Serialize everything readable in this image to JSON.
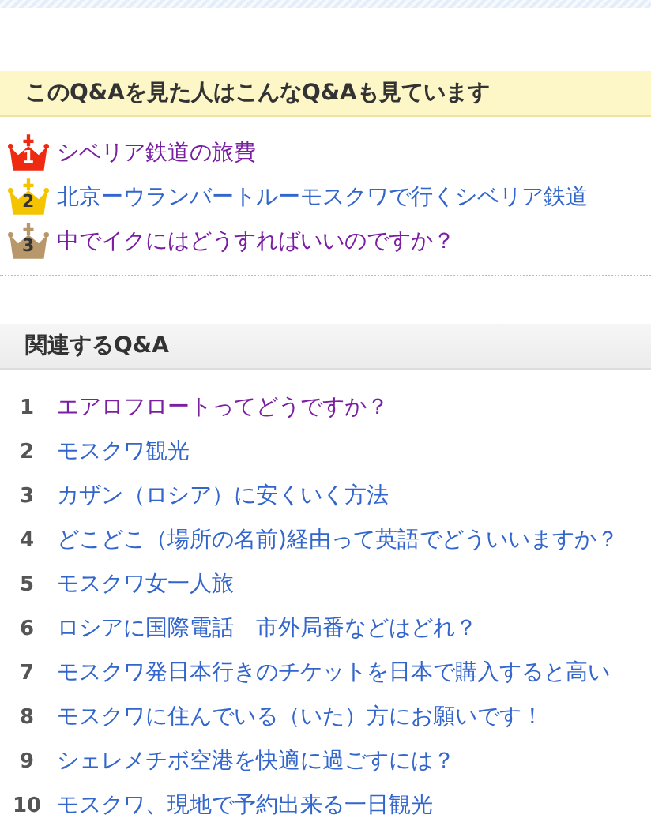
{
  "also_viewed": {
    "title": "このQ&Aを見た人はこんなQ&Aも見ています",
    "items": [
      {
        "rank": "1",
        "color": "#ee2a10",
        "title": "シベリア鉄道の旅費",
        "visited": true
      },
      {
        "rank": "2",
        "color": "#f5c400",
        "title": "北京ーウランバートルーモスクワで行くシベリア鉄道",
        "visited": false
      },
      {
        "rank": "3",
        "color": "#b8986a",
        "title": "中でイクにはどうすればいいのですか？",
        "visited": true
      }
    ]
  },
  "related": {
    "title": "関連するQ&A",
    "items": [
      {
        "rank": "1",
        "title": "エアロフロートってどうですか？",
        "visited": true
      },
      {
        "rank": "2",
        "title": "モスクワ観光",
        "visited": false
      },
      {
        "rank": "3",
        "title": "カザン（ロシア）に安くいく方法",
        "visited": false
      },
      {
        "rank": "4",
        "title": "どこどこ（場所の名前)経由って英語でどういいますか？",
        "visited": false
      },
      {
        "rank": "5",
        "title": "モスクワ女一人旅",
        "visited": false
      },
      {
        "rank": "6",
        "title": "ロシアに国際電話　市外局番などはどれ？",
        "visited": false
      },
      {
        "rank": "7",
        "title": "モスクワ発日本行きのチケットを日本で購入すると高い",
        "visited": false
      },
      {
        "rank": "8",
        "title": "モスクワに住んでいる（いた）方にお願いです！",
        "visited": false
      },
      {
        "rank": "9",
        "title": "シェレメチボ空港を快適に過ごすには？",
        "visited": false
      },
      {
        "rank": "10",
        "title": "モスクワ、現地で予約出来る一日観光",
        "visited": false
      }
    ]
  }
}
